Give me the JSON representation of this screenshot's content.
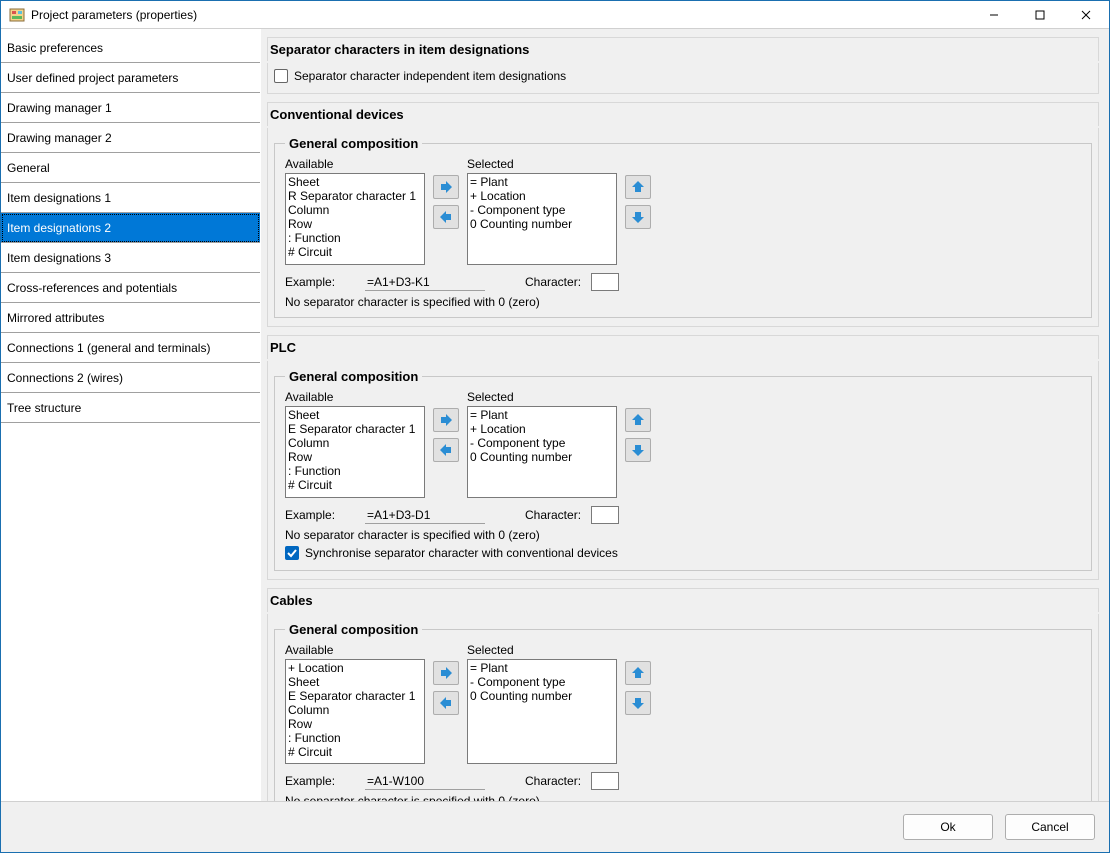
{
  "window": {
    "title": "Project parameters (properties)"
  },
  "nav": {
    "items": [
      "Basic preferences",
      "User defined project parameters",
      "Drawing manager 1",
      "Drawing manager 2",
      "General",
      "Item designations 1",
      "Item designations 2",
      "Item designations 3",
      "Cross-references and potentials",
      "Mirrored attributes",
      "Connections 1 (general and terminals)",
      "Connections 2 (wires)",
      "Tree structure"
    ],
    "selected_index": 6
  },
  "sep": {
    "heading": "Separator characters in item designations",
    "independent_label": "Separator character independent item designations",
    "independent_checked": false
  },
  "labels": {
    "general_composition": "General composition",
    "available": "Available",
    "selected": "Selected",
    "example": "Example:",
    "character": "Character:",
    "zero_hint": "No separator character is specified with 0 (zero)",
    "sync_label": "Synchronise separator character with conventional devices"
  },
  "conv": {
    "heading": "Conventional devices",
    "available": [
      "Sheet",
      "R Separator character 1",
      "Column",
      "Row",
      ": Function",
      "# Circuit"
    ],
    "selected": [
      "= Plant",
      "+ Location",
      "- Component type",
      "0 Counting number"
    ],
    "example": "=A1+D3-K1",
    "character": ""
  },
  "plc": {
    "heading": "PLC",
    "available": [
      "Sheet",
      "E Separator character 1",
      "Column",
      "Row",
      ": Function",
      "# Circuit"
    ],
    "selected": [
      "= Plant",
      "+ Location",
      "- Component type",
      "0 Counting number"
    ],
    "example": "=A1+D3-D1",
    "character": "",
    "sync_checked": true
  },
  "cables": {
    "heading": "Cables",
    "available": [
      "+ Location",
      "Sheet",
      "E Separator character 1",
      "Column",
      "Row",
      ": Function",
      "# Circuit"
    ],
    "selected": [
      "= Plant",
      "- Component type",
      "0 Counting number"
    ],
    "example": "=A1-W100",
    "character": "",
    "sync_checked": true
  },
  "buttons": {
    "ok": "Ok",
    "cancel": "Cancel"
  }
}
